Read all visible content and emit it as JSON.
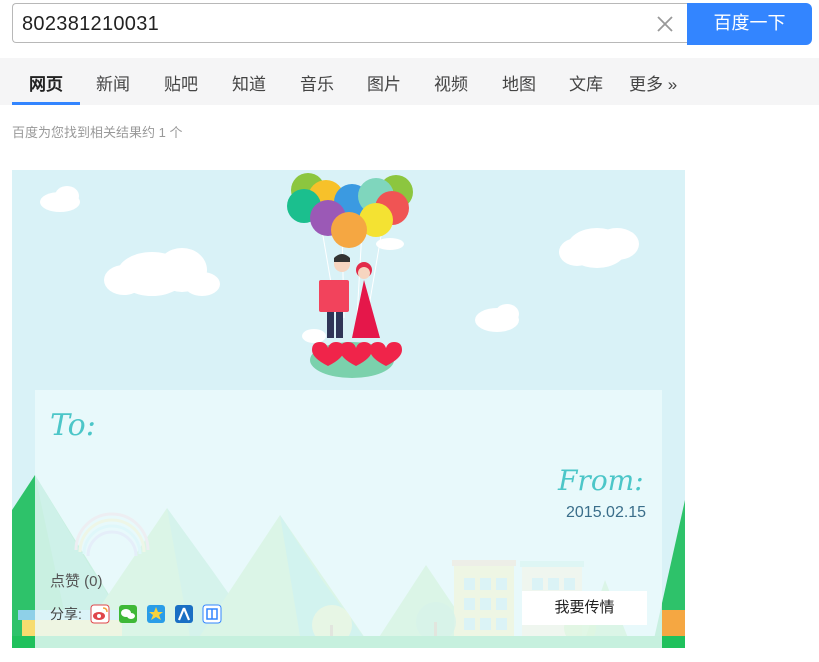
{
  "search": {
    "query": "802381210031",
    "button_label": "百度一下"
  },
  "tabs": [
    {
      "label": "网页",
      "active": true
    },
    {
      "label": "新闻"
    },
    {
      "label": "贴吧"
    },
    {
      "label": "知道"
    },
    {
      "label": "音乐"
    },
    {
      "label": "图片"
    },
    {
      "label": "视频"
    },
    {
      "label": "地图"
    },
    {
      "label": "文库"
    },
    {
      "label": "更多 »"
    }
  ],
  "result_count": "百度为您找到相关结果约 1 个",
  "card": {
    "to_label": "To:",
    "from_label": "From:",
    "date": "2015.02.15",
    "like": "点赞 (0)",
    "share_label": "分享:",
    "share_icons": [
      "weibo-icon",
      "wechat-icon",
      "qzone-icon",
      "renren-icon",
      "tieba-icon"
    ],
    "spread_button": "我要传情"
  },
  "colors": {
    "accent": "#3385ff",
    "sky": "#d9f2f7",
    "title_teal": "#4cc6c8"
  }
}
